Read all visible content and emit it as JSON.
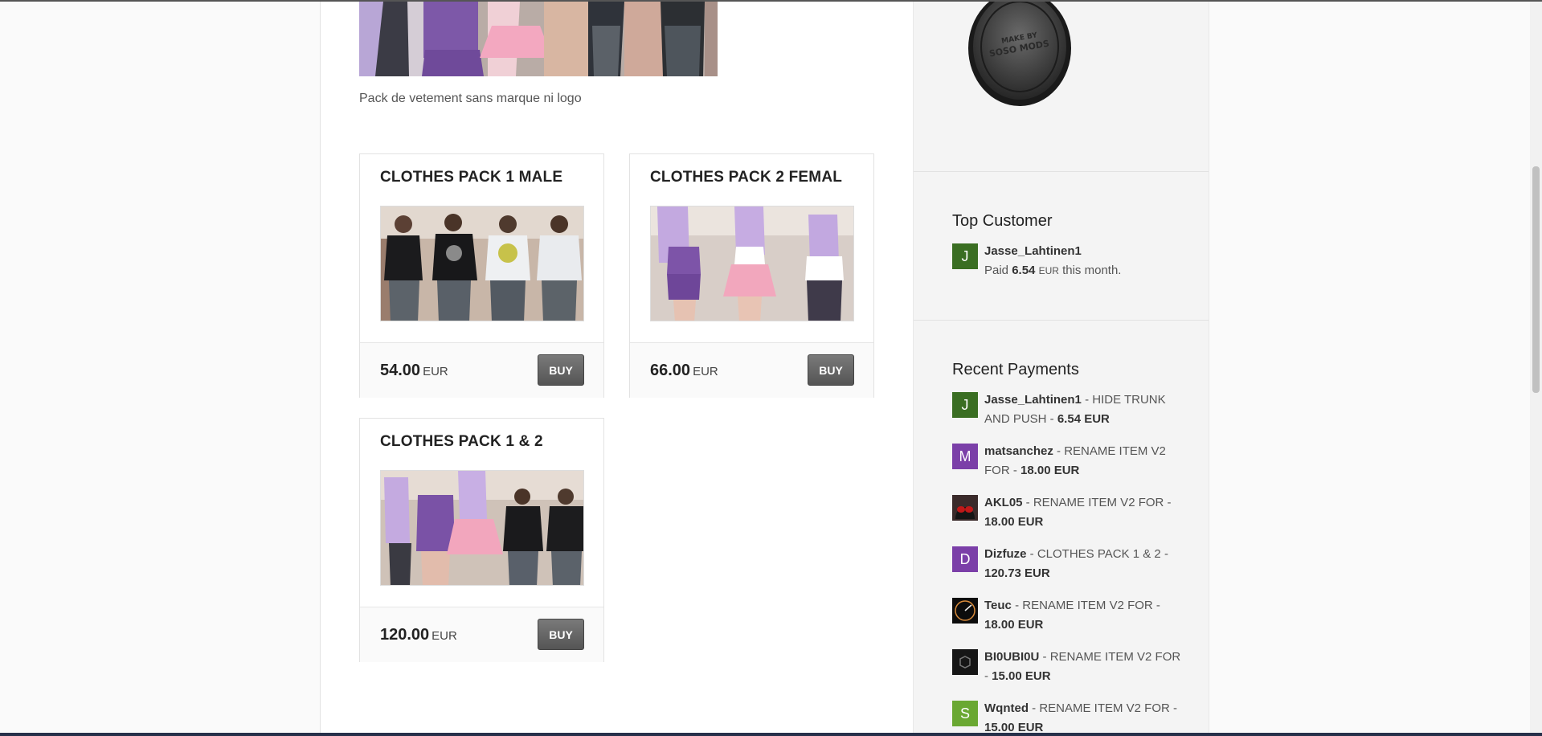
{
  "hero": {
    "description": "Pack de vetement sans marque ni logo"
  },
  "products": [
    {
      "title": "CLOTHES PACK 1 MALE",
      "price": "54.00",
      "currency": "EUR",
      "buy_label": "BUY"
    },
    {
      "title": "CLOTHES PACK 2 FEMAL",
      "price": "66.00",
      "currency": "EUR",
      "buy_label": "BUY"
    },
    {
      "title": "CLOTHES PACK 1 & 2",
      "price": "120.00",
      "currency": "EUR",
      "buy_label": "BUY"
    }
  ],
  "badge": {
    "line1": "MAKE BY",
    "line2": "SOSO MODS"
  },
  "top_customer": {
    "heading": "Top Customer",
    "avatar_letter": "J",
    "avatar_color": "#3a6e22",
    "name": "Jasse_Lahtinen1",
    "paid_prefix": "Paid",
    "amount": "6.54",
    "currency": "EUR",
    "paid_suffix": "this month."
  },
  "recent_payments": {
    "heading": "Recent Payments",
    "items": [
      {
        "name": "Jasse_Lahtinen1",
        "item": " - HIDE TRUNK AND PUSH - ",
        "amount": "6.54 EUR",
        "avatar_letter": "J",
        "avatar_color": "#3a6e22",
        "avatar_type": "letter"
      },
      {
        "name": "matsanchez",
        "item": " - RENAME ITEM V2 FOR - ",
        "amount": "18.00 EUR",
        "avatar_letter": "M",
        "avatar_color": "#7b3fa8",
        "avatar_type": "letter"
      },
      {
        "name": "AKL05",
        "item": " - RENAME ITEM V2 FOR - ",
        "amount": "18.00 EUR",
        "avatar_letter": "",
        "avatar_color": "#5a1010",
        "avatar_type": "helmet"
      },
      {
        "name": "Dizfuze",
        "item": " - CLOTHES PACK 1 & 2 - ",
        "amount": "120.73 EUR",
        "avatar_letter": "D",
        "avatar_color": "#7b3fa8",
        "avatar_type": "letter"
      },
      {
        "name": "Teuc",
        "item": " - RENAME ITEM V2 FOR - ",
        "amount": "18.00 EUR",
        "avatar_letter": "",
        "avatar_color": "#111111",
        "avatar_type": "orb"
      },
      {
        "name": "BI0UBI0U",
        "item": " - RENAME ITEM V2 FOR - ",
        "amount": "15.00 EUR",
        "avatar_letter": "",
        "avatar_color": "#1a1a1a",
        "avatar_type": "cube"
      },
      {
        "name": "Wqnted",
        "item": " - RENAME ITEM V2 FOR - ",
        "amount": "15.00 EUR",
        "avatar_letter": "S",
        "avatar_color": "#6aa832",
        "avatar_type": "letter"
      }
    ]
  }
}
